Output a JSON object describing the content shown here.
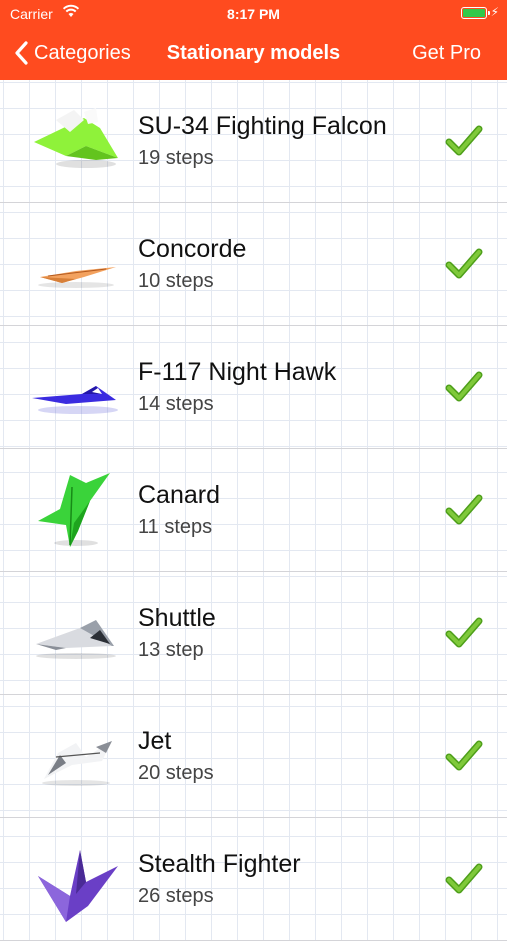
{
  "status_bar": {
    "carrier": "Carrier",
    "time": "8:17 PM",
    "battery_color": "#33c94a"
  },
  "nav": {
    "back_label": "Categories",
    "title": "Stationary models",
    "action_label": "Get Pro",
    "background": "#ff4b1f"
  },
  "models": [
    {
      "name": "SU-34 Fighting Falcon",
      "steps": "19 steps",
      "icon": "green-fighter-plane-icon",
      "completed": true
    },
    {
      "name": "Concorde",
      "steps": "10 steps",
      "icon": "orange-concorde-plane-icon",
      "completed": true
    },
    {
      "name": "F-117 Night Hawk",
      "steps": "14 steps",
      "icon": "blue-stealth-plane-icon",
      "completed": true
    },
    {
      "name": "Canard",
      "steps": "11 steps",
      "icon": "green-canard-plane-icon",
      "completed": true
    },
    {
      "name": "Shuttle",
      "steps": "13 step",
      "icon": "gray-shuttle-plane-icon",
      "completed": true
    },
    {
      "name": "Jet",
      "steps": "20 steps",
      "icon": "white-jet-plane-icon",
      "completed": true
    },
    {
      "name": "Stealth Fighter",
      "steps": "26 steps",
      "icon": "purple-stealth-fighter-icon",
      "completed": true
    }
  ]
}
